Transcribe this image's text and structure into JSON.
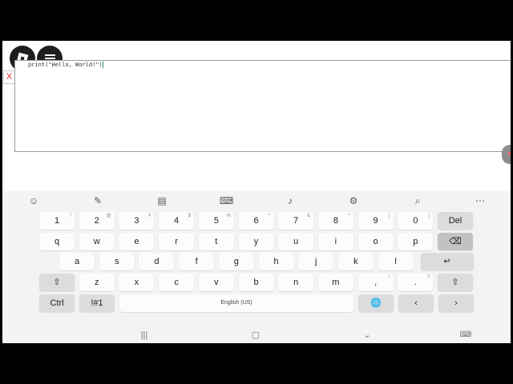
{
  "editor": {
    "code_text": "print(\"Hello, World!\")"
  },
  "overlay": {
    "close_label": "X"
  },
  "toolbar": {
    "icons": [
      "emoji-icon",
      "handwriting-icon",
      "clipboard-icon",
      "keyboard-mode-icon",
      "microphone-icon",
      "settings-icon",
      "search-icon",
      "more-icon"
    ]
  },
  "keyboard": {
    "row_numbers": [
      {
        "label": "1",
        "sup": "!"
      },
      {
        "label": "2",
        "sup": "@"
      },
      {
        "label": "3",
        "sup": "#"
      },
      {
        "label": "4",
        "sup": "$"
      },
      {
        "label": "5",
        "sup": "%"
      },
      {
        "label": "6",
        "sup": "^"
      },
      {
        "label": "7",
        "sup": "&"
      },
      {
        "label": "8",
        "sup": "*"
      },
      {
        "label": "9",
        "sup": "("
      },
      {
        "label": "0",
        "sup": ")"
      },
      {
        "label": "Del",
        "sup": ""
      }
    ],
    "row_q": [
      "q",
      "w",
      "e",
      "r",
      "t",
      "y",
      "u",
      "i",
      "o",
      "p",
      "⌫"
    ],
    "row_a": [
      "a",
      "s",
      "d",
      "f",
      "g",
      "h",
      "j",
      "k",
      "l",
      "↵"
    ],
    "row_z": [
      {
        "label": "⇧",
        "sup": ""
      },
      {
        "label": "z",
        "sup": ""
      },
      {
        "label": "x",
        "sup": ""
      },
      {
        "label": "c",
        "sup": ""
      },
      {
        "label": "v",
        "sup": ""
      },
      {
        "label": "b",
        "sup": ""
      },
      {
        "label": "n",
        "sup": ""
      },
      {
        "label": "m",
        "sup": ""
      },
      {
        "label": ",",
        "sup": "!"
      },
      {
        "label": ".",
        "sup": "?"
      },
      {
        "label": "⇧",
        "sup": ""
      }
    ],
    "row_bottom": [
      "Ctrl",
      "!#1",
      "English (US)",
      "🌐",
      "‹",
      "›"
    ]
  },
  "navbar": {
    "recents": "|||",
    "home": "▢",
    "back": "⌄",
    "keyboard": "⌨"
  }
}
